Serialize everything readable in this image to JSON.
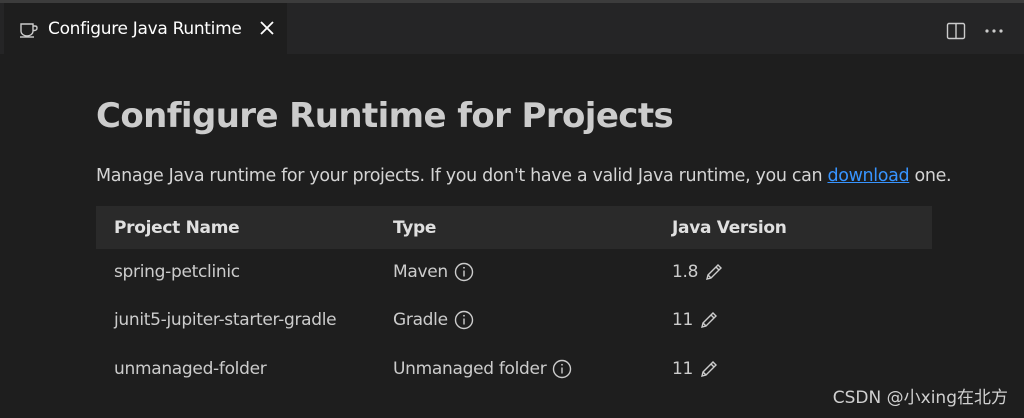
{
  "tab": {
    "title": "Configure Java Runtime",
    "icon": "coffee-cup-icon"
  },
  "actions": [
    {
      "name": "split-editor-icon"
    },
    {
      "name": "more-actions-icon"
    }
  ],
  "page": {
    "title": "Configure Runtime for Projects",
    "description_before": "Manage Java runtime for your projects. If you don't have a valid Java runtime, you can ",
    "description_link": "download",
    "description_after": " one."
  },
  "table": {
    "headers": {
      "name": "Project Name",
      "type": "Type",
      "version": "Java Version"
    },
    "rows": [
      {
        "name": "spring-petclinic",
        "type": "Maven",
        "version": "1.8"
      },
      {
        "name": "junit5-jupiter-starter-gradle",
        "type": "Gradle",
        "version": "11"
      },
      {
        "name": "unmanaged-folder",
        "type": "Unmanaged folder",
        "version": "11"
      }
    ]
  },
  "watermark": "CSDN @小xing在北方",
  "colors": {
    "background": "#1e1e1e",
    "link": "#3794ff",
    "header_row": "#2a2a2a"
  }
}
